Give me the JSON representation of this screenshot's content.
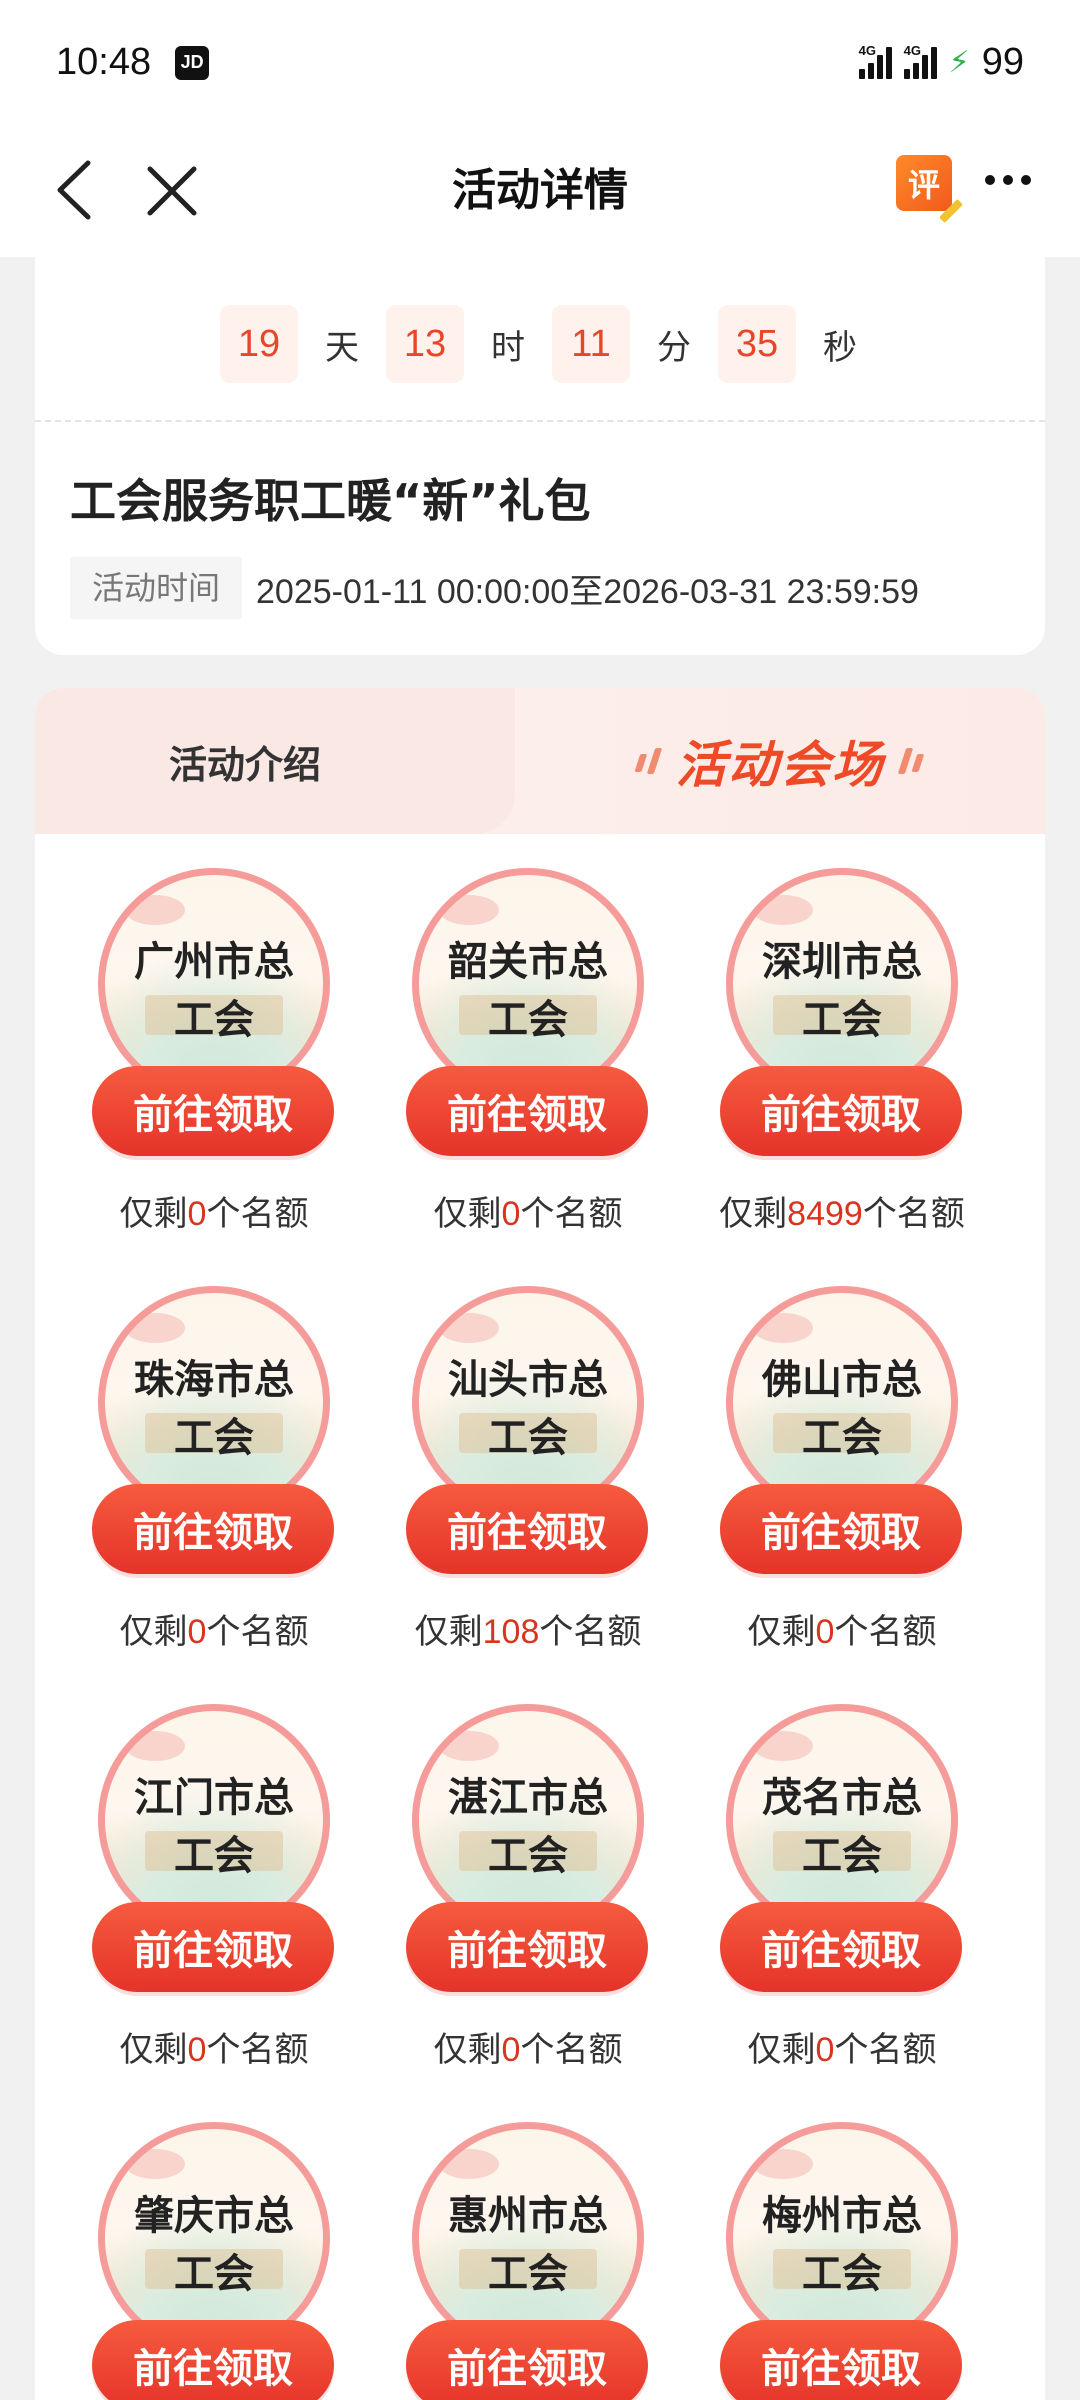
{
  "status_bar": {
    "time": "10:48",
    "app_badge": "JD",
    "signal1_tag": "4G",
    "signal2_tag": "4G",
    "battery": "99"
  },
  "nav": {
    "title": "活动详情",
    "review_icon_text": "评"
  },
  "countdown": {
    "days": "19",
    "days_unit": "天",
    "hours": "13",
    "hours_unit": "时",
    "minutes": "11",
    "minutes_unit": "分",
    "seconds": "35",
    "seconds_unit": "秒"
  },
  "activity": {
    "title": "工会服务职工暖“新”礼包",
    "time_label": "活动时间",
    "time_value": "2025-01-11 00:00:00至2026-03-31 23:59:59"
  },
  "tabs": {
    "intro": "活动介绍",
    "venue": "活动会场"
  },
  "venues": [
    {
      "line1": "广州市总",
      "line2": "工会",
      "button": "前往领取",
      "quota_prefix": "仅剩",
      "quota": "0",
      "quota_suffix": "个名额"
    },
    {
      "line1": "韶关市总",
      "line2": "工会",
      "button": "前往领取",
      "quota_prefix": "仅剩",
      "quota": "0",
      "quota_suffix": "个名额"
    },
    {
      "line1": "深圳市总",
      "line2": "工会",
      "button": "前往领取",
      "quota_prefix": "仅剩",
      "quota": "8499",
      "quota_suffix": "个名额"
    },
    {
      "line1": "珠海市总",
      "line2": "工会",
      "button": "前往领取",
      "quota_prefix": "仅剩",
      "quota": "0",
      "quota_suffix": "个名额"
    },
    {
      "line1": "汕头市总",
      "line2": "工会",
      "button": "前往领取",
      "quota_prefix": "仅剩",
      "quota": "108",
      "quota_suffix": "个名额"
    },
    {
      "line1": "佛山市总",
      "line2": "工会",
      "button": "前往领取",
      "quota_prefix": "仅剩",
      "quota": "0",
      "quota_suffix": "个名额"
    },
    {
      "line1": "江门市总",
      "line2": "工会",
      "button": "前往领取",
      "quota_prefix": "仅剩",
      "quota": "0",
      "quota_suffix": "个名额"
    },
    {
      "line1": "湛江市总",
      "line2": "工会",
      "button": "前往领取",
      "quota_prefix": "仅剩",
      "quota": "0",
      "quota_suffix": "个名额"
    },
    {
      "line1": "茂名市总",
      "line2": "工会",
      "button": "前往领取",
      "quota_prefix": "仅剩",
      "quota": "0",
      "quota_suffix": "个名额"
    },
    {
      "line1": "肇庆市总",
      "line2": "工会",
      "button": "前往领取"
    },
    {
      "line1": "惠州市总",
      "line2": "工会",
      "button": "前往领取"
    },
    {
      "line1": "梅州市总",
      "line2": "工会",
      "button": "前往领取"
    }
  ]
}
